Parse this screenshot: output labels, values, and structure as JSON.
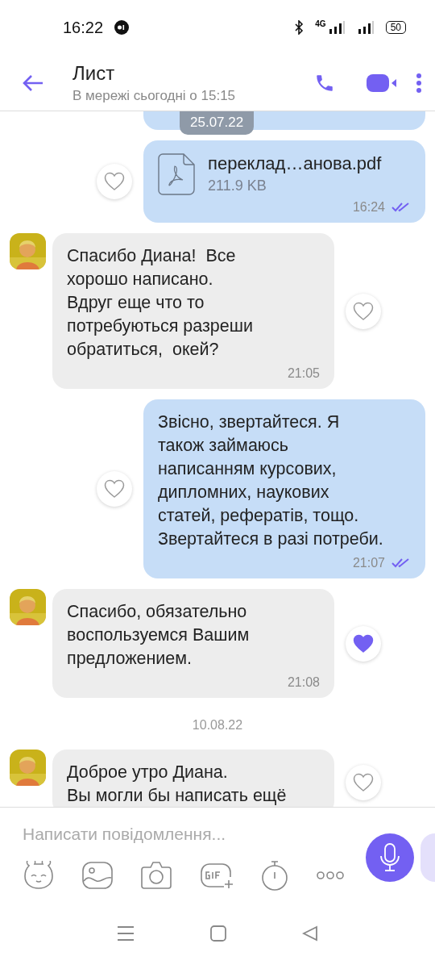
{
  "status_bar": {
    "time": "16:22",
    "network": "4G",
    "battery": "50"
  },
  "header": {
    "title": "Лист",
    "subtitle": "В мережі сьогодні о 15:15"
  },
  "sticky_date": "25.07.22",
  "messages": [
    {
      "kind": "cut",
      "outgoing": true
    },
    {
      "kind": "file",
      "outgoing": true,
      "file_name": "переклад…анова.pdf",
      "file_size": "211.9 KB",
      "time": "16:24",
      "liked": false
    },
    {
      "kind": "text",
      "outgoing": false,
      "text": "Спасибо Диана!  Все\nхорошо написано.\nВдруг еще что то\nпотребуються разреши\nобратиться,  окей?",
      "time": "21:05",
      "liked": false
    },
    {
      "kind": "text",
      "outgoing": true,
      "text": "Звісно, звертайтеся. Я\nтакож займаюсь\nнаписанням курсових,\nдипломних, наукових\nстатей, рефератів, тощо.\nЗвертайтеся в разі потреби.",
      "time": "21:07",
      "liked": false
    },
    {
      "kind": "text",
      "outgoing": false,
      "text": "Спасибо, обязательно\nвоспользуемся Вашим\nпредложением.",
      "time": "21:08",
      "liked": true
    },
    {
      "kind": "date",
      "text": "10.08.22"
    },
    {
      "kind": "text",
      "outgoing": false,
      "text": "Доброе утро Диана.\nВы могли бы написать ещё",
      "liked": false
    }
  ],
  "composer": {
    "placeholder": "Написати повідомлення..."
  }
}
